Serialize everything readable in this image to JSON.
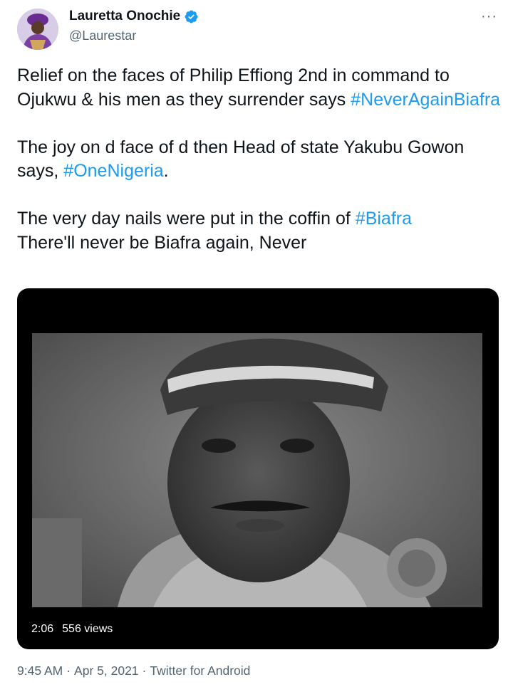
{
  "author": {
    "display_name": "Lauretta Onochie",
    "handle": "@Laurestar",
    "verified": true,
    "avatar_icon": "profile-photo",
    "more_icon": "more-horizontal-icon",
    "more_label": "···"
  },
  "tweet": {
    "paragraphs": [
      {
        "parts": [
          {
            "text": "Relief on the faces of Philip Effiong 2nd in command to Ojukwu & his men as they surrender says ",
            "hashtag": false
          },
          {
            "text": "#NeverAgainBiafra",
            "hashtag": true
          }
        ]
      },
      {
        "parts": [
          {
            "text": "The joy on d face of d then Head of state Yakubu Gowon says, ",
            "hashtag": false
          },
          {
            "text": "#OneNigeria",
            "hashtag": true
          },
          {
            "text": ".",
            "hashtag": false
          }
        ]
      },
      {
        "parts": [
          {
            "text": "The very day nails were put in the coffin of ",
            "hashtag": false
          },
          {
            "text": "#Biafra",
            "hashtag": true
          },
          {
            "text": "\nThere'll never be Biafra again, Never",
            "hashtag": false
          }
        ]
      }
    ]
  },
  "media": {
    "type": "video",
    "duration": "2:06",
    "views": "556 views"
  },
  "footer": {
    "time": "9:45 AM",
    "date": "Apr 5, 2021",
    "separator": "·",
    "source": "Twitter for Android"
  },
  "colors": {
    "link": "#1d9bf0",
    "text": "#0f1419",
    "secondary": "#536471",
    "verified_badge": "#1d9bf0"
  }
}
